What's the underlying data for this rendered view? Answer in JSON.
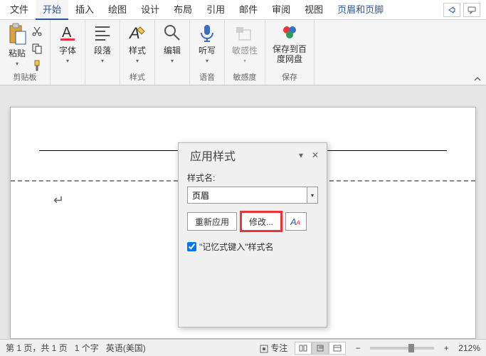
{
  "tabs": {
    "file": "文件",
    "home": "开始",
    "insert": "插入",
    "draw": "绘图",
    "design": "设计",
    "layout": "布局",
    "references": "引用",
    "mail": "邮件",
    "review": "审阅",
    "view": "视图",
    "context": "页眉和页脚"
  },
  "ribbon": {
    "clipboard": {
      "paste": "粘贴",
      "group": "剪贴板"
    },
    "font": {
      "label": "字体"
    },
    "paragraph": {
      "label": "段落"
    },
    "styles": {
      "label": "样式",
      "group": "样式"
    },
    "editing": {
      "label": "编辑"
    },
    "dictate": {
      "label": "听写",
      "group": "语音"
    },
    "sensitivity": {
      "label": "敏感性",
      "group": "敏感度"
    },
    "baidu": {
      "label": "保存到百度网盘",
      "group": "保存"
    }
  },
  "pane": {
    "title": "应用样式",
    "styleNameLabel": "样式名:",
    "styleValue": "页眉",
    "reapply": "重新应用",
    "modify": "修改...",
    "autocomplete": "\"记忆式键入\"样式名"
  },
  "status": {
    "pages": "第 1 页，共 1 页",
    "words": "1 个字",
    "language": "英语(美国)",
    "focus": "专注",
    "zoom": "212%"
  },
  "paraMark": "↵"
}
